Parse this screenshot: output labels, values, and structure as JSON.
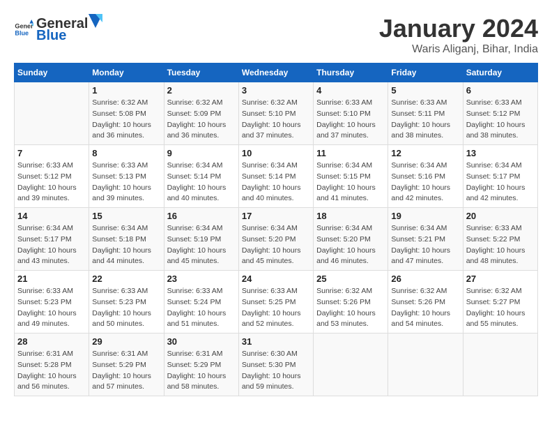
{
  "logo": {
    "text_general": "General",
    "text_blue": "Blue"
  },
  "header": {
    "month": "January 2024",
    "location": "Waris Aliganj, Bihar, India"
  },
  "days_of_week": [
    "Sunday",
    "Monday",
    "Tuesday",
    "Wednesday",
    "Thursday",
    "Friday",
    "Saturday"
  ],
  "weeks": [
    [
      {
        "day": "",
        "details": ""
      },
      {
        "day": "1",
        "details": "Sunrise: 6:32 AM\nSunset: 5:08 PM\nDaylight: 10 hours\nand 36 minutes."
      },
      {
        "day": "2",
        "details": "Sunrise: 6:32 AM\nSunset: 5:09 PM\nDaylight: 10 hours\nand 36 minutes."
      },
      {
        "day": "3",
        "details": "Sunrise: 6:32 AM\nSunset: 5:10 PM\nDaylight: 10 hours\nand 37 minutes."
      },
      {
        "day": "4",
        "details": "Sunrise: 6:33 AM\nSunset: 5:10 PM\nDaylight: 10 hours\nand 37 minutes."
      },
      {
        "day": "5",
        "details": "Sunrise: 6:33 AM\nSunset: 5:11 PM\nDaylight: 10 hours\nand 38 minutes."
      },
      {
        "day": "6",
        "details": "Sunrise: 6:33 AM\nSunset: 5:12 PM\nDaylight: 10 hours\nand 38 minutes."
      }
    ],
    [
      {
        "day": "7",
        "details": "Sunrise: 6:33 AM\nSunset: 5:12 PM\nDaylight: 10 hours\nand 39 minutes."
      },
      {
        "day": "8",
        "details": "Sunrise: 6:33 AM\nSunset: 5:13 PM\nDaylight: 10 hours\nand 39 minutes."
      },
      {
        "day": "9",
        "details": "Sunrise: 6:34 AM\nSunset: 5:14 PM\nDaylight: 10 hours\nand 40 minutes."
      },
      {
        "day": "10",
        "details": "Sunrise: 6:34 AM\nSunset: 5:14 PM\nDaylight: 10 hours\nand 40 minutes."
      },
      {
        "day": "11",
        "details": "Sunrise: 6:34 AM\nSunset: 5:15 PM\nDaylight: 10 hours\nand 41 minutes."
      },
      {
        "day": "12",
        "details": "Sunrise: 6:34 AM\nSunset: 5:16 PM\nDaylight: 10 hours\nand 42 minutes."
      },
      {
        "day": "13",
        "details": "Sunrise: 6:34 AM\nSunset: 5:17 PM\nDaylight: 10 hours\nand 42 minutes."
      }
    ],
    [
      {
        "day": "14",
        "details": "Sunrise: 6:34 AM\nSunset: 5:17 PM\nDaylight: 10 hours\nand 43 minutes."
      },
      {
        "day": "15",
        "details": "Sunrise: 6:34 AM\nSunset: 5:18 PM\nDaylight: 10 hours\nand 44 minutes."
      },
      {
        "day": "16",
        "details": "Sunrise: 6:34 AM\nSunset: 5:19 PM\nDaylight: 10 hours\nand 45 minutes."
      },
      {
        "day": "17",
        "details": "Sunrise: 6:34 AM\nSunset: 5:20 PM\nDaylight: 10 hours\nand 45 minutes."
      },
      {
        "day": "18",
        "details": "Sunrise: 6:34 AM\nSunset: 5:20 PM\nDaylight: 10 hours\nand 46 minutes."
      },
      {
        "day": "19",
        "details": "Sunrise: 6:34 AM\nSunset: 5:21 PM\nDaylight: 10 hours\nand 47 minutes."
      },
      {
        "day": "20",
        "details": "Sunrise: 6:33 AM\nSunset: 5:22 PM\nDaylight: 10 hours\nand 48 minutes."
      }
    ],
    [
      {
        "day": "21",
        "details": "Sunrise: 6:33 AM\nSunset: 5:23 PM\nDaylight: 10 hours\nand 49 minutes."
      },
      {
        "day": "22",
        "details": "Sunrise: 6:33 AM\nSunset: 5:23 PM\nDaylight: 10 hours\nand 50 minutes."
      },
      {
        "day": "23",
        "details": "Sunrise: 6:33 AM\nSunset: 5:24 PM\nDaylight: 10 hours\nand 51 minutes."
      },
      {
        "day": "24",
        "details": "Sunrise: 6:33 AM\nSunset: 5:25 PM\nDaylight: 10 hours\nand 52 minutes."
      },
      {
        "day": "25",
        "details": "Sunrise: 6:32 AM\nSunset: 5:26 PM\nDaylight: 10 hours\nand 53 minutes."
      },
      {
        "day": "26",
        "details": "Sunrise: 6:32 AM\nSunset: 5:26 PM\nDaylight: 10 hours\nand 54 minutes."
      },
      {
        "day": "27",
        "details": "Sunrise: 6:32 AM\nSunset: 5:27 PM\nDaylight: 10 hours\nand 55 minutes."
      }
    ],
    [
      {
        "day": "28",
        "details": "Sunrise: 6:31 AM\nSunset: 5:28 PM\nDaylight: 10 hours\nand 56 minutes."
      },
      {
        "day": "29",
        "details": "Sunrise: 6:31 AM\nSunset: 5:29 PM\nDaylight: 10 hours\nand 57 minutes."
      },
      {
        "day": "30",
        "details": "Sunrise: 6:31 AM\nSunset: 5:29 PM\nDaylight: 10 hours\nand 58 minutes."
      },
      {
        "day": "31",
        "details": "Sunrise: 6:30 AM\nSunset: 5:30 PM\nDaylight: 10 hours\nand 59 minutes."
      },
      {
        "day": "",
        "details": ""
      },
      {
        "day": "",
        "details": ""
      },
      {
        "day": "",
        "details": ""
      }
    ]
  ]
}
